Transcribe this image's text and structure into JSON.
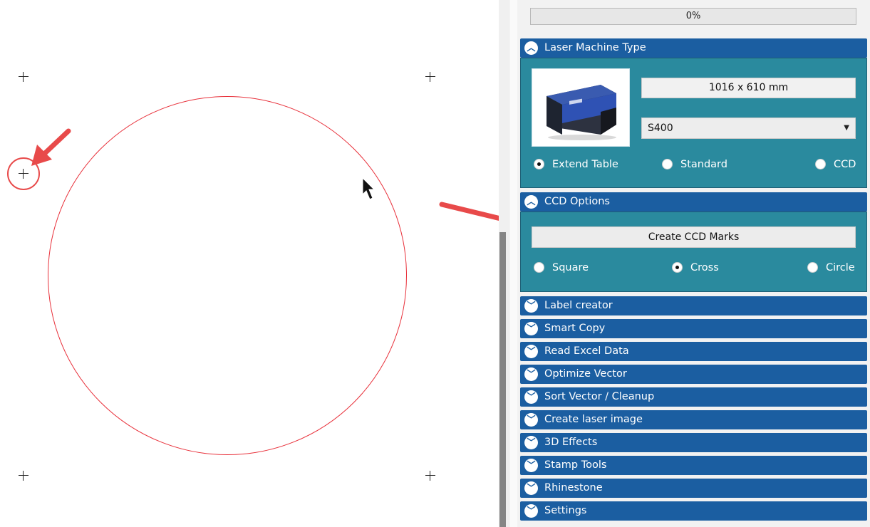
{
  "progress": {
    "label": "0%",
    "value": 0
  },
  "laser_machine": {
    "title": "Laser Machine Type",
    "size": "1016 x 610 mm",
    "model": "S400",
    "radios": [
      {
        "label": "Extend Table",
        "selected": true
      },
      {
        "label": "Standard",
        "selected": false
      },
      {
        "label": "CCD",
        "selected": false
      }
    ]
  },
  "ccd_options": {
    "title": "CCD Options",
    "button": "Create CCD Marks",
    "radios": [
      {
        "label": "Square",
        "selected": false
      },
      {
        "label": "Cross",
        "selected": true
      },
      {
        "label": "Circle",
        "selected": false
      }
    ]
  },
  "collapsed_sections": [
    {
      "title": "Label creator"
    },
    {
      "title": "Smart Copy"
    },
    {
      "title": "Read Excel Data"
    },
    {
      "title": "Optimize Vector"
    },
    {
      "title": "Sort Vector / Cleanup"
    },
    {
      "title": "Create laser image"
    },
    {
      "title": "3D Effects"
    },
    {
      "title": "Stamp Tools"
    },
    {
      "title": "Rhinestone"
    },
    {
      "title": "Settings"
    }
  ],
  "colors": {
    "header_blue": "#1b5ea1",
    "body_teal": "#2a8a9e",
    "design_red": "#e8303a",
    "arrow_red": "#e84a4a"
  },
  "icons": {
    "expanded": "chevron-up-icon",
    "collapsed": "chevron-down-icon"
  }
}
